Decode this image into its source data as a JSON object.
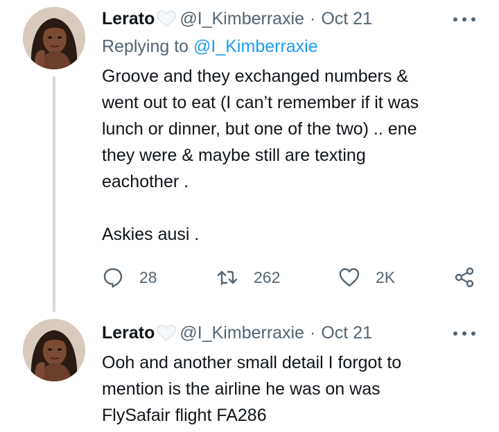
{
  "tweets": [
    {
      "author_name": "Lerato",
      "handle": "@I_Kimberraxie",
      "separator": "·",
      "date": "Oct 21",
      "replying_prefix": "Replying to",
      "replying_handle": "@I_Kimberraxie",
      "text": "Groove and they exchanged numbers &\nwent out to eat (I can’t remember if it was\nlunch or dinner, but one of the two) .. ene\nthey were & maybe still are texting\neachother .\n\nAskies ausi .",
      "replies": "28",
      "retweets": "262",
      "likes": "2K"
    },
    {
      "author_name": "Lerato",
      "handle": "@I_Kimberraxie",
      "separator": "·",
      "date": "Oct 21",
      "text": "Ooh and another small detail I forgot to\nmention  is the airline he was on was\nFlySafair flight FA286"
    }
  ],
  "icons": {
    "badge": "white-heart-icon",
    "more": "more-options-icon",
    "reply": "reply-icon",
    "retweet": "retweet-icon",
    "like": "like-icon",
    "share": "share-icon"
  },
  "colors": {
    "text": "#0f1419",
    "secondary": "#536471",
    "link": "#1d9bf0",
    "thread_line": "#cfd9de"
  }
}
